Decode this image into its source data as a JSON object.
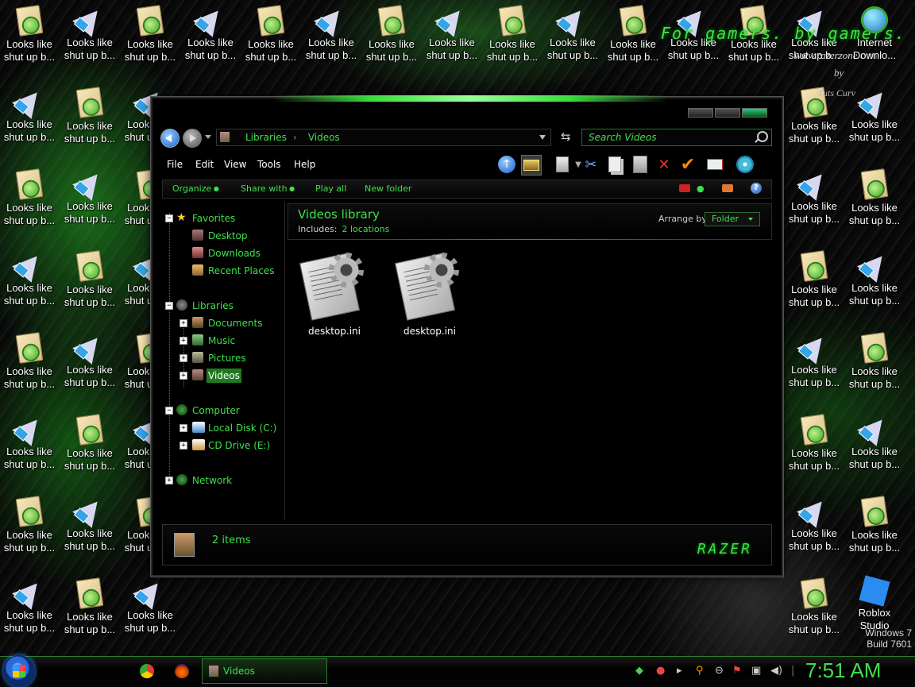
{
  "desktop": {
    "shortcut_line1": "Looks like",
    "shortcut_line2": "shut up b...",
    "banner_text": "For gamers. by gamers.",
    "watermark": "www.razerzone.com",
    "watermark_by": "by",
    "watermark_author": "Tuts Curv",
    "ie_line1": "Internet",
    "ie_line2": "Downlo...",
    "roblox_line1": "Roblox",
    "roblox_line2": "Studio",
    "build_line1": "Windows 7",
    "build_line2": "Build 7601"
  },
  "window": {
    "breadcrumb": [
      "Libraries",
      "Videos"
    ],
    "search_placeholder": "Search Videos",
    "menu": [
      "File",
      "Edit",
      "View",
      "Tools",
      "Help"
    ],
    "commands": [
      "Organize",
      "Share with",
      "Play all",
      "New folder"
    ],
    "help_label": "?",
    "nav_tree": {
      "favorites": "Favorites",
      "favorites_items": [
        "Desktop",
        "Downloads",
        "Recent Places"
      ],
      "libraries": "Libraries",
      "libraries_items": [
        "Documents",
        "Music",
        "Pictures",
        "Videos"
      ],
      "computer": "Computer",
      "computer_items": [
        "Local Disk (C:)",
        "CD Drive (E:)"
      ],
      "network": "Network"
    },
    "library": {
      "title": "Videos library",
      "includes_label": "Includes:",
      "locations": "2 locations",
      "arrange_label": "Arrange by:",
      "arrange_value": "Folder"
    },
    "files": [
      "desktop.ini",
      "desktop.ini"
    ],
    "status": {
      "count": "2 items",
      "logo": "RAZER"
    }
  },
  "taskbar": {
    "task_label": "Videos",
    "clock": "7:51 AM"
  },
  "colors": {
    "accent": "#3ee04a",
    "background": "#000000"
  }
}
